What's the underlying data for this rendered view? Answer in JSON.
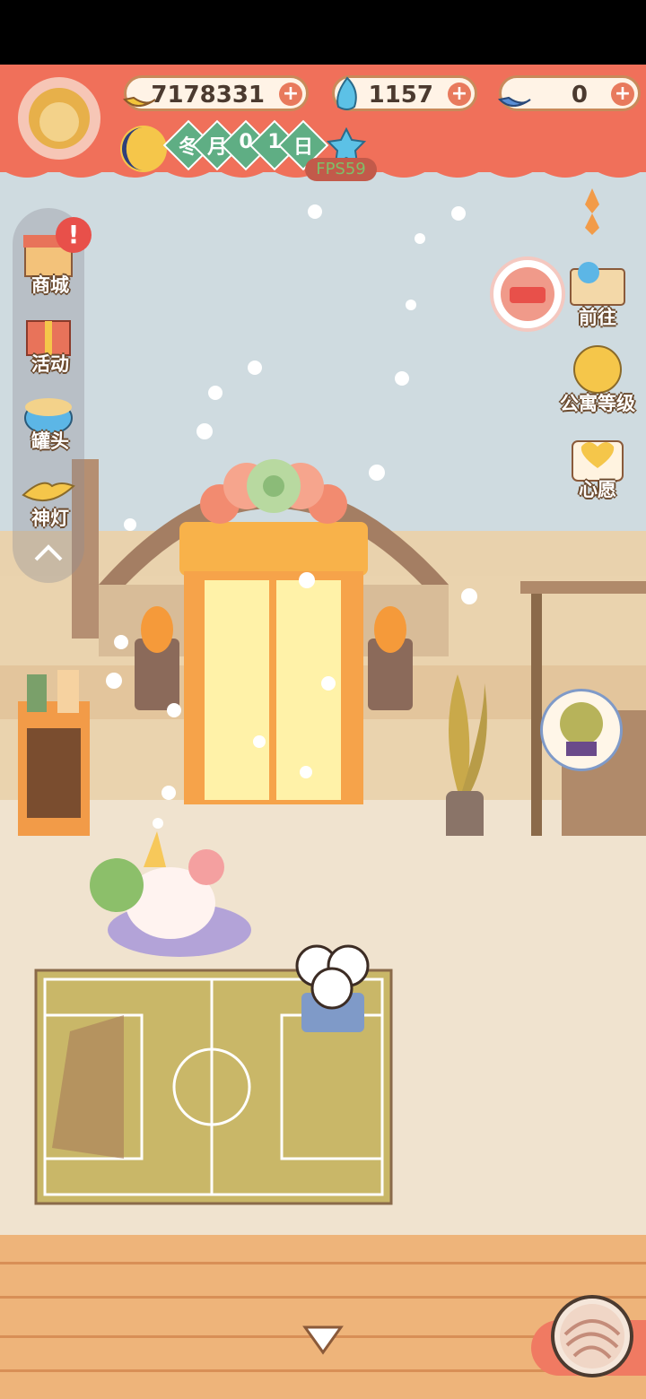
{
  "currencies": [
    {
      "name": "banana",
      "value": "7178331",
      "icon": "banana-icon"
    },
    {
      "name": "blue-flame",
      "value": "1157",
      "icon": "blue-flame-icon"
    },
    {
      "name": "blue-banana",
      "value": "0",
      "icon": "blue-banana-icon"
    }
  ],
  "plus_symbol": "+",
  "date": {
    "season": "冬",
    "month_label": "月",
    "day_digit_1": "0",
    "day_digit_2": "1",
    "day_label": "日"
  },
  "fps_label": "FPS59",
  "left_menu": [
    {
      "label": "商城",
      "icon": "shop-icon"
    },
    {
      "label": "活动",
      "icon": "gift-icon"
    },
    {
      "label": "罐头",
      "icon": "can-icon"
    },
    {
      "label": "神灯",
      "icon": "magic-lamp-icon"
    }
  ],
  "notification_mark": "!",
  "right_menu": [
    {
      "label": "前往",
      "icon": "map-pin-icon"
    },
    {
      "label": "公寓等级",
      "icon": "apartment-level-icon"
    },
    {
      "label": "心愿",
      "icon": "wish-book-icon"
    }
  ],
  "colors": {
    "banner": "#f0705a",
    "sky": "#cfdbe0",
    "floor": "#eeb47a",
    "field": "#c9b768"
  }
}
